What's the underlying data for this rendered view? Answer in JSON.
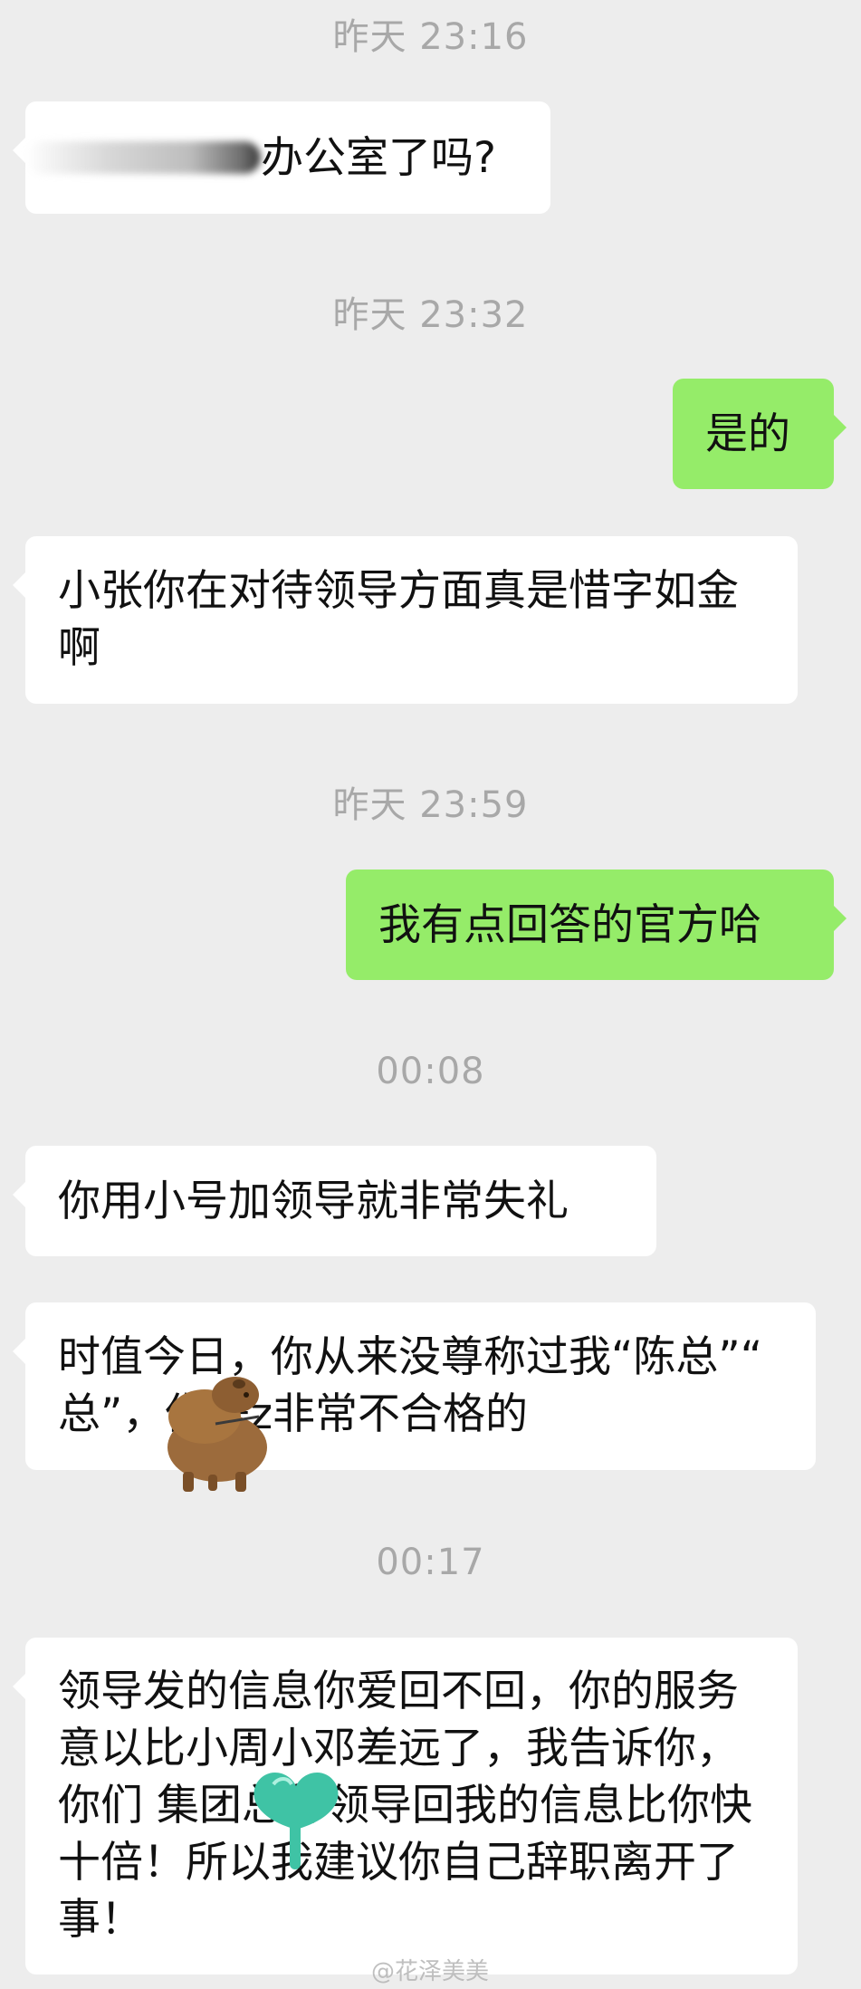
{
  "timestamps": [
    "昨天 23:16",
    "昨天 23:32",
    "昨天 23:59",
    "00:08",
    "00:17"
  ],
  "messages": [
    {
      "side": "in",
      "text": "办公室了吗?"
    },
    {
      "side": "out",
      "text": "是的"
    },
    {
      "side": "in",
      "text": "小张你在对待领导方面真是惜字如金啊"
    },
    {
      "side": "out",
      "text": "我有点回答的官方哈"
    },
    {
      "side": "in",
      "text": "你用小号加领导就非常失礼"
    },
    {
      "side": "in",
      "text": "时值今日，你从来没尊称过我“陈总”“ 总”，你是z非常不合格的"
    },
    {
      "side": "in",
      "text": "领导发的信息你爱回不回，你的服务意以比小周小邓差远了，我告诉你，你们 集团总部领导回我的信息比你快十倍！所以我建议你自己辞职离开了事！"
    }
  ],
  "watermark": "@花泽美美",
  "stickers": [
    "capybara-sticker",
    "green-heart-sticker"
  ],
  "colors": {
    "background": "#ededed",
    "incoming": "#ffffff",
    "outgoing": "#95ec69",
    "timestamp": "#a8a8a8"
  }
}
